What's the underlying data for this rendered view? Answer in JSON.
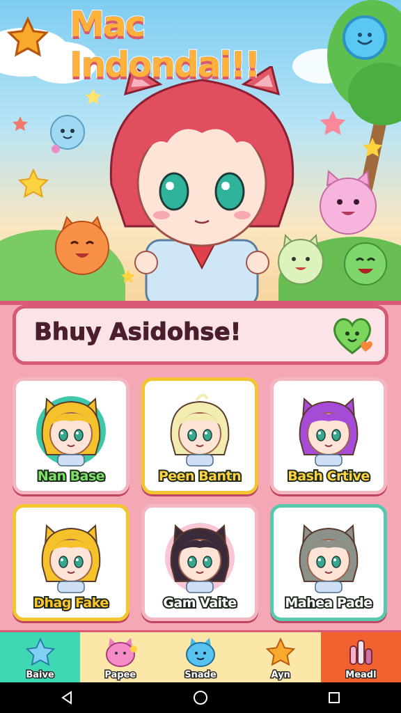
{
  "game": {
    "title": "Mac Indondai!!"
  },
  "banner": {
    "text": "Bhuy Asidohse!"
  },
  "characters": [
    {
      "name": "Nan Base",
      "name_color": "#7ee06a",
      "border": "#f4b6c2",
      "bg": "#3ec7a8",
      "hair": "#f6c22b",
      "ears": "cat"
    },
    {
      "name": "Peen Bantn",
      "name_color": "#ffd23f",
      "border": "#f2c531",
      "bg": "#ffffff",
      "hair": "#f3ecb0",
      "ears": "none"
    },
    {
      "name": "Bash Crtive",
      "name_color": "#ffd23f",
      "border": "#f4b6c2",
      "bg": "#ffffff",
      "hair": "#a64ad8",
      "ears": "cat"
    },
    {
      "name": "Dhag Fake",
      "name_color": "#ffc629",
      "border": "#f2c531",
      "bg": "#ffffff",
      "hair": "#f6c22b",
      "ears": "cat"
    },
    {
      "name": "Gam Vaite",
      "name_color": "#ffffff",
      "border": "#f4b6c2",
      "bg": "#f8c6d6",
      "hair": "#3b2b3a",
      "ears": "cat"
    },
    {
      "name": "Mahea Pade",
      "name_color": "#ffffff",
      "border": "#58c9b0",
      "bg": "#ffffff",
      "hair": "#8c918a",
      "ears": "cat"
    }
  ],
  "nav": {
    "items": [
      {
        "label": "Baive",
        "icon": "star-icon",
        "bg": "#3ed8b4"
      },
      {
        "label": "Papee",
        "icon": "pink-blob-icon",
        "bg": "#fbe7a8"
      },
      {
        "label": "Snade",
        "icon": "blue-blob-icon",
        "bg": "#fbe7a8"
      },
      {
        "label": "Ayn",
        "icon": "orange-star-icon",
        "bg": "#fbe7a8"
      },
      {
        "label": "Meadl",
        "icon": "bars-icon",
        "bg": "#f2622e"
      }
    ]
  },
  "system_nav": {
    "back_icon": "back-triangle-icon",
    "home_icon": "home-circle-icon",
    "recents_icon": "recents-square-icon"
  },
  "colors": {
    "accent": "#d95a74",
    "panel": "#f4a8b6",
    "banner_bg": "#fbe3e8"
  }
}
